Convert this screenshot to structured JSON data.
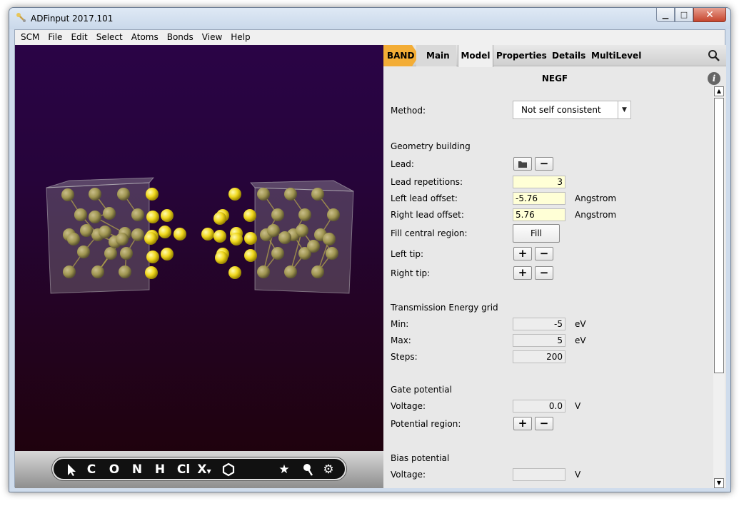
{
  "window": {
    "title": "ADFinput 2017.101",
    "minimize": "▁",
    "maximize": "□",
    "close": "✕"
  },
  "menu": [
    "SCM",
    "File",
    "Edit",
    "Select",
    "Atoms",
    "Bonds",
    "View",
    "Help"
  ],
  "toolbar": {
    "tools": [
      "pointer-icon",
      "C",
      "O",
      "N",
      "H",
      "Cl",
      "X",
      "ring-icon",
      "star-icon",
      "lollipop-icon",
      "gear-icon"
    ],
    "labels": {
      "c": "C",
      "o": "O",
      "n": "N",
      "h": "H",
      "cl": "Cl",
      "x": "X"
    }
  },
  "tabs": {
    "band": "BAND",
    "main": "Main",
    "model": "Model",
    "properties": "Properties",
    "details": "Details",
    "multilevel": "MultiLevel"
  },
  "panel": {
    "title": "NEGF",
    "method": {
      "label": "Method:",
      "value": "Not self consistent"
    },
    "geometry": {
      "heading": "Geometry building",
      "lead_label": "Lead:",
      "lead_repetitions": {
        "label": "Lead repetitions:",
        "value": "3"
      },
      "left_lead_offset": {
        "label": "Left lead offset:",
        "value": "-5.76",
        "unit": "Angstrom"
      },
      "right_lead_offset": {
        "label": "Right lead offset:",
        "value": "5.76",
        "unit": "Angstrom"
      },
      "fill_central": {
        "label": "Fill central region:",
        "button": "Fill"
      },
      "left_tip": "Left tip:",
      "right_tip": "Right tip:"
    },
    "transmission": {
      "heading": "Transmission Energy grid",
      "min": {
        "label": "Min:",
        "value": "-5",
        "unit": "eV"
      },
      "max": {
        "label": "Max:",
        "value": "5",
        "unit": "eV"
      },
      "steps": {
        "label": "Steps:",
        "value": "200"
      }
    },
    "gate": {
      "heading": "Gate potential",
      "voltage": {
        "label": "Voltage:",
        "value": "0.0",
        "unit": "V"
      },
      "region": "Potential region:"
    },
    "bias": {
      "heading": "Bias potential",
      "voltage": {
        "label": "Voltage:",
        "value": "",
        "unit": "V"
      }
    },
    "plus": "+",
    "minus": "−"
  },
  "colors": {
    "accent_tab": "#f3ad36",
    "atom": "#f2dc2a",
    "input_highlight": "#ffffd6"
  }
}
